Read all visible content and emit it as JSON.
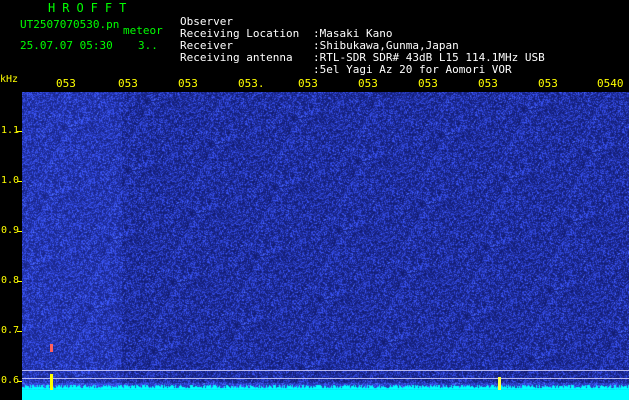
{
  "header": {
    "app_title": "HROFFT",
    "file_name": "UT2507070530.pn",
    "tag": "meteor",
    "datetime": "25.07.07 05:30",
    "counter": "3.."
  },
  "station_info": [
    {
      "label": "Observer",
      "value": ":Masaki Kano"
    },
    {
      "label": "Receiving Location",
      "value": ":Shibukawa,Gunma,Japan"
    },
    {
      "label": "Receiver",
      "value": ":RTL-SDR SDR# 43dB L15 114.1MHz USB"
    },
    {
      "label": "Receiving antenna",
      "value": ":5el Yagi Az 20 for Aomori VOR"
    }
  ],
  "axis": {
    "freq_unit": "kHz",
    "freq_ticks": [
      "1.1",
      "1.0",
      "0.9",
      "0.8",
      "0.7",
      "0.6"
    ],
    "time_ticks": [
      "053",
      "053",
      "053",
      "053.",
      "053",
      "053",
      "053",
      "053",
      "053",
      "0540"
    ]
  },
  "colors": {
    "text_green": "#00ff00",
    "axis_yellow": "#ffff00",
    "waterfall_bg": "#0b1270",
    "signal_cyan": "#00ffff",
    "meteor_yellow": "#ffff00"
  }
}
